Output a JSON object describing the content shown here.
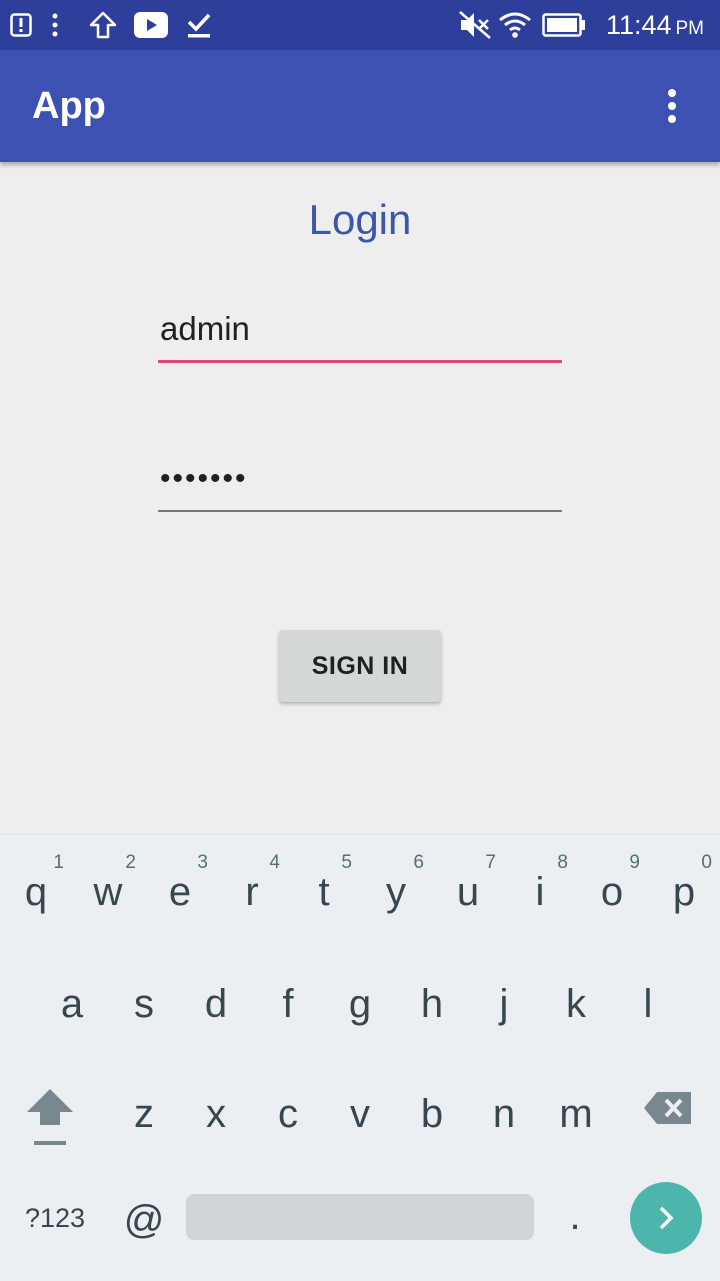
{
  "status_bar": {
    "time": "11:44",
    "ampm": "PM",
    "left_icons": [
      "alert-icon",
      "more-vert-small-icon",
      "upload-arrow-icon",
      "youtube-icon",
      "download-done-icon"
    ],
    "right_icons": [
      "mute-icon",
      "wifi-icon",
      "battery-icon"
    ]
  },
  "app_bar": {
    "title": "App",
    "background": "#3d51b3",
    "overflow_icon": "more-vert-icon"
  },
  "login": {
    "title": "Login",
    "title_color": "#3d56a6",
    "username_value": "admin",
    "password_value": "•••••••",
    "active_underline_color": "#e0457d",
    "signin_label": "SIGN IN"
  },
  "keyboard": {
    "row1": [
      {
        "key": "q",
        "hint": "1"
      },
      {
        "key": "w",
        "hint": "2"
      },
      {
        "key": "e",
        "hint": "3"
      },
      {
        "key": "r",
        "hint": "4"
      },
      {
        "key": "t",
        "hint": "5"
      },
      {
        "key": "y",
        "hint": "6"
      },
      {
        "key": "u",
        "hint": "7"
      },
      {
        "key": "i",
        "hint": "8"
      },
      {
        "key": "o",
        "hint": "9"
      },
      {
        "key": "p",
        "hint": "0"
      }
    ],
    "row2": [
      "a",
      "s",
      "d",
      "f",
      "g",
      "h",
      "j",
      "k",
      "l"
    ],
    "row3": [
      "z",
      "x",
      "c",
      "v",
      "b",
      "n",
      "m"
    ],
    "symbols_label": "?123",
    "at_label": "@",
    "period_label": ".",
    "shift_icon": "shift-icon",
    "backspace_icon": "backspace-icon",
    "enter_icon": "chevron-right-icon",
    "enter_color": "#4db6ac"
  }
}
